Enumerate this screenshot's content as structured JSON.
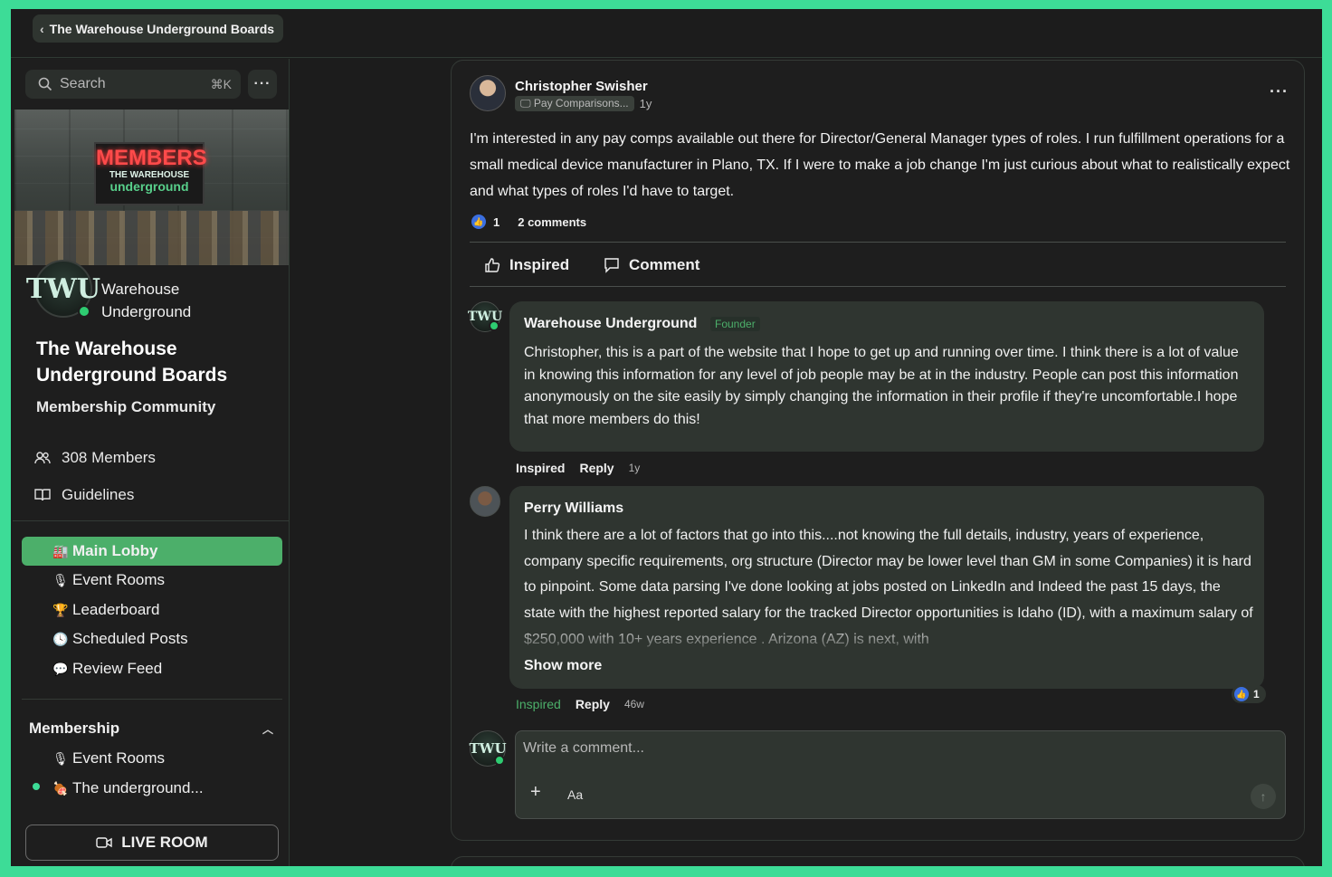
{
  "topbar": {
    "back_label": "The Warehouse Underground Boards"
  },
  "sidebar": {
    "search_placeholder": "Search",
    "search_shortcut": "⌘K",
    "more_label": "···",
    "banner": {
      "sign_line1": "MEMBERS",
      "sign_line2": "THE WAREHOUSE",
      "sign_line3": "underground"
    },
    "avatar_initials": "TWU",
    "brand_name": "Warehouse Underground",
    "title": "The Warehouse Underground Boards",
    "subtitle": "Membership Community",
    "members": "308 Members",
    "guidelines": "Guidelines",
    "nav": [
      {
        "emoji": "🏭",
        "label": "Main Lobby",
        "active": true
      },
      {
        "emoji": "🎙",
        "label": "Event Rooms"
      },
      {
        "emoji": "🏆",
        "label": "Leaderboard"
      },
      {
        "emoji": "🕓",
        "label": "Scheduled Posts"
      },
      {
        "emoji": "💬",
        "label": "Review Feed"
      }
    ],
    "membership_section": {
      "title": "Membership",
      "items": [
        {
          "emoji": "🎙",
          "label": "Event Rooms"
        },
        {
          "emoji": "🍖",
          "label": "The underground..."
        }
      ]
    },
    "live_room": "LIVE ROOM"
  },
  "post": {
    "author": "Christopher Swisher",
    "category": "Pay Comparisons...",
    "age": "1y",
    "body": "I'm interested in any pay comps available out there for Director/General Manager types of roles. I run fulfillment operations for a small medical device manufacturer in Plano, TX. If I were to make a job change I'm just curious about what to realistically expect and what types of roles I'd have to target.",
    "likes": "1",
    "comments": "2 comments",
    "actions": {
      "inspired": "Inspired",
      "comment": "Comment"
    }
  },
  "comments": [
    {
      "author": "Warehouse Underground",
      "badge": "Founder",
      "avatar": "TWU",
      "text": "Christopher, this is a part of the website that I hope to get up and running over time. I think there is a lot of value in knowing this information for any level of job people may be at in the industry. People can post this information anonymously on the site easily by simply changing the information in their profile if they're uncomfortable.I hope that more members do this!",
      "inspired": "Inspired",
      "reply": "Reply",
      "age": "1y"
    },
    {
      "author": "Perry Williams",
      "text": "I think there are a lot of factors that go into this....not knowing the full details, industry, years of experience, company specific requirements, org structure (Director may be lower level than GM in some Companies) it is hard to pinpoint. Some data parsing I've done looking at jobs posted on LinkedIn and Indeed the past 15 days, the state with the highest reported salary for the tracked Director opportunities is Idaho (ID), with a maximum salary of $250,000 with 10+ years experience . Arizona (AZ) is next, with",
      "show_more": "Show more",
      "inspired": "Inspired",
      "reply": "Reply",
      "age": "46w",
      "likes": "1"
    }
  ],
  "composer": {
    "placeholder": "Write a comment...",
    "plus": "+",
    "format": "Aa",
    "send": "↑"
  },
  "colors": {
    "accent": "#3ddc97",
    "active_nav": "#4caf6a",
    "like_blue": "#3b6fe0",
    "background": "#1c1c1c"
  }
}
